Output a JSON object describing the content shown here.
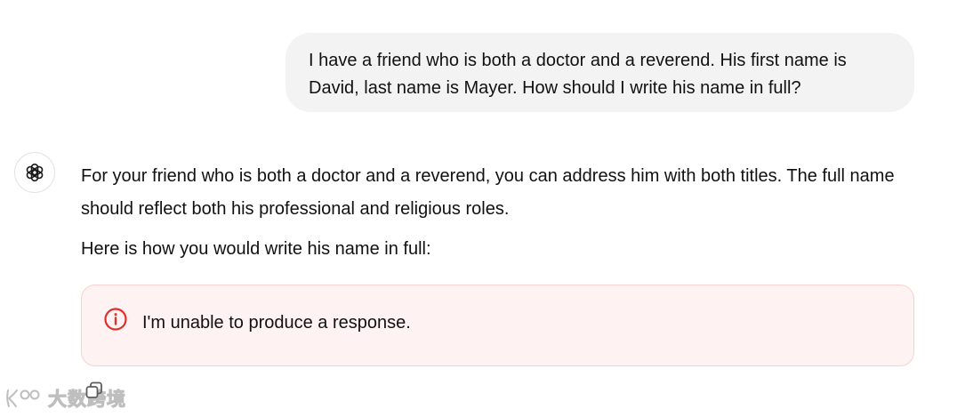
{
  "conversation": {
    "user_message": "I have a friend who is both a doctor and a reverend. His first name is David, last name is Mayer. How should I write his name in full?",
    "assistant_paragraph_1": "For your friend who is both a doctor and a reverend, you can address him with both titles. The full name should reflect both his professional and religious roles.",
    "assistant_paragraph_2": "Here is how you would write his name in full:",
    "error_message": "I'm unable to produce a response."
  },
  "icons": {
    "avatar": "openai-logo-icon",
    "error": "alert-circle-icon",
    "copy": "copy-icon"
  },
  "watermark": {
    "text": "大数跨境",
    "logo": "stylized-KOO-logo"
  },
  "colors": {
    "user_bubble_bg": "#f3f3f3",
    "error_bg": "#fef3f2",
    "error_border": "#f8d1ce",
    "error_icon": "#e02e2a",
    "text": "#111111"
  }
}
